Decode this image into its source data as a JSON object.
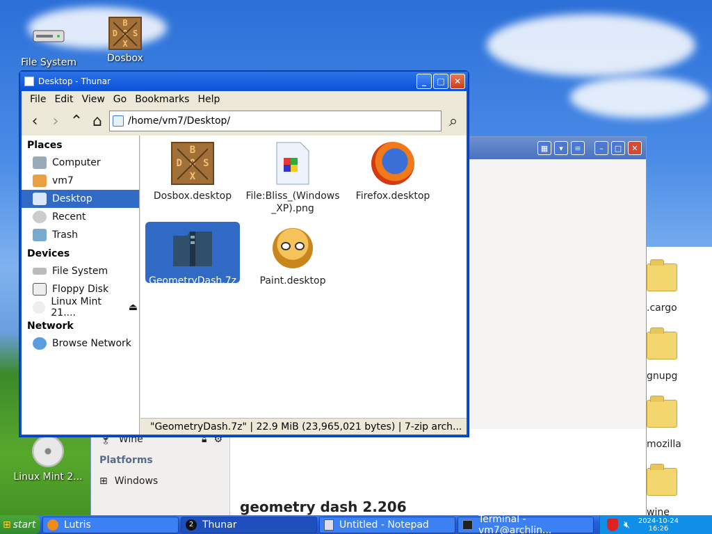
{
  "desktop": {
    "icons": [
      {
        "label": "File System",
        "icon": "drive-icon"
      },
      {
        "label": "Dosbox",
        "icon": "dosbox-icon"
      },
      {
        "label": "Linux Mint 2...",
        "icon": "cdrom-icon"
      }
    ]
  },
  "background_window": {
    "sidebar": {
      "item_wine": "Wine",
      "platforms_header": "Platforms",
      "item_windows": "Windows"
    },
    "game_title": "geometry dash 2.206",
    "folders": [
      ".cargo",
      "gnupg",
      "mozilla",
      "wine"
    ]
  },
  "thunar": {
    "title": "Desktop - Thunar",
    "menu": [
      "File",
      "Edit",
      "View",
      "Go",
      "Bookmarks",
      "Help"
    ],
    "path": "/home/vm7/Desktop/",
    "sidebar": {
      "places_header": "Places",
      "places": [
        {
          "label": "Computer",
          "icon": "computer-icon"
        },
        {
          "label": "vm7",
          "icon": "home-icon"
        },
        {
          "label": "Desktop",
          "icon": "desktop-icon",
          "selected": true
        },
        {
          "label": "Recent",
          "icon": "recent-icon"
        },
        {
          "label": "Trash",
          "icon": "trash-icon"
        }
      ],
      "devices_header": "Devices",
      "devices": [
        {
          "label": "File System",
          "icon": "drive-icon"
        },
        {
          "label": "Floppy Disk",
          "icon": "floppy-icon"
        },
        {
          "label": "Linux Mint 21....",
          "icon": "cdrom-icon"
        }
      ],
      "network_header": "Network",
      "network": [
        {
          "label": "Browse Network",
          "icon": "network-icon"
        }
      ]
    },
    "files": [
      {
        "label": "Dosbox.desktop",
        "icon": "dosbox-icon"
      },
      {
        "label": "File:Bliss_(Windows _XP).png",
        "icon": "image-file-icon"
      },
      {
        "label": "Firefox.desktop",
        "icon": "firefox-icon"
      },
      {
        "label": "GeometryDash.7z",
        "icon": "archive-icon",
        "selected": true
      },
      {
        "label": "Paint.desktop",
        "icon": "paint-icon"
      }
    ],
    "status": "\"GeometryDash.7z\"  |  22.9 MiB (23,965,021 bytes)  |  7-zip arch..."
  },
  "taskbar": {
    "start_label": "start",
    "tasks": [
      {
        "label": "Lutris",
        "icon": "lutris-icon"
      },
      {
        "label": "Thunar",
        "icon": "folder-icon",
        "badge": "2"
      },
      {
        "label": "Untitled - Notepad",
        "icon": "notepad-icon"
      },
      {
        "label": "Terminal - vm7@archlin...",
        "icon": "terminal-icon"
      }
    ],
    "date": "2024-10-24",
    "time": "16:26"
  },
  "colors": {
    "selection": "#316ac5",
    "xp_title": "#0a50d8"
  }
}
